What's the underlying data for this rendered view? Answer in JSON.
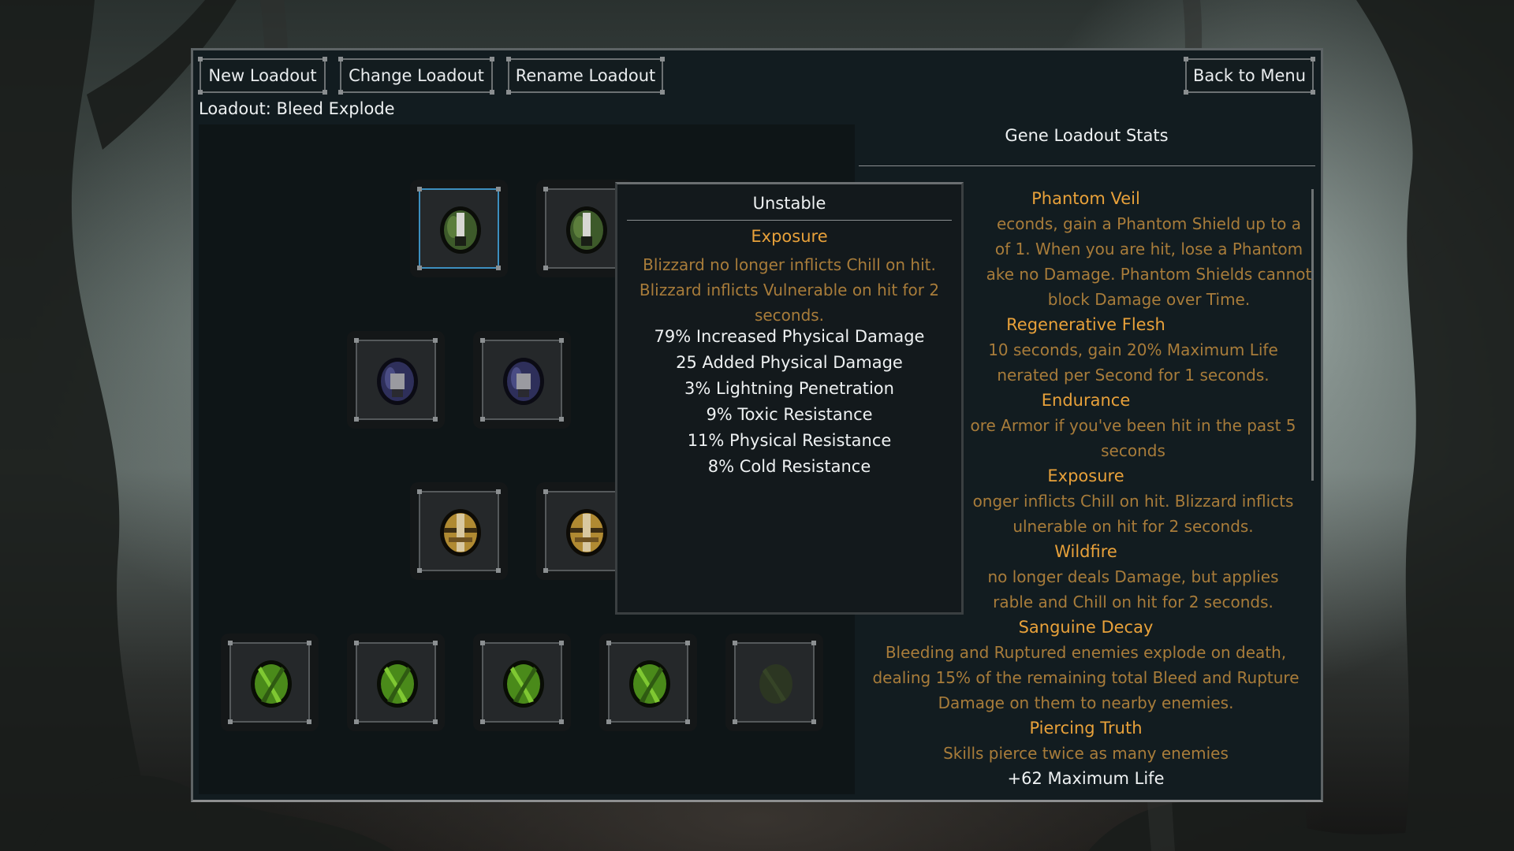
{
  "toolbar": {
    "new_loadout": "New Loadout",
    "change_loadout": "Change Loadout",
    "rename_loadout": "Rename Loadout",
    "back_to_menu": "Back to Menu"
  },
  "loadout_label": "Loadout: Bleed Explode",
  "gene_rows": [
    {
      "genes": [
        "green-gene",
        "green-gene"
      ],
      "selected_index": 0
    },
    {
      "genes": [
        "purple-gene",
        "purple-gene"
      ]
    },
    {
      "genes": [
        "gold-gene",
        "gold-gene"
      ]
    },
    {
      "genes": [
        "lime-gene",
        "lime-gene",
        "lime-gene",
        "lime-gene",
        "dim-lime-gene"
      ]
    }
  ],
  "tooltip": {
    "title": "Unstable",
    "gene_name": "Exposure",
    "description": "Blizzard no longer inflicts Chill on hit. Blizzard inflicts Vulnerable on hit for 2 seconds.",
    "stats": [
      "79% Increased Physical Damage",
      "25 Added Physical Damage",
      "3% Lightning Penetration",
      "9% Toxic Resistance",
      "11% Physical Resistance",
      "8% Cold Resistance"
    ]
  },
  "stats_panel": {
    "title": "Gene Loadout Stats",
    "entries": [
      {
        "name": "Phantom Veil",
        "desc": "econds, gain a Phantom Shield up to a\nof 1. When you are hit, lose a Phantom\nake no Damage. Phantom Shields cannot\nblock Damage over Time."
      },
      {
        "name": "Regenerative Flesh",
        "desc": "10 seconds, gain 20% Maximum Life\nnerated per Second for 1 seconds."
      },
      {
        "name": "Endurance",
        "desc": "ore Armor if you've been hit in the past 5\nseconds"
      },
      {
        "name": "Exposure",
        "desc": "onger inflicts Chill on hit. Blizzard inflicts\nulnerable on hit for 2 seconds."
      },
      {
        "name": "Wildfire",
        "desc": "no longer deals Damage, but applies\nrable and Chill on hit for 2 seconds."
      },
      {
        "name": "Sanguine Decay",
        "desc": "Bleeding and Ruptured enemies explode on death,\ndealing 15% of the remaining total Bleed and Rupture\nDamage on them to nearby enemies."
      },
      {
        "name": "Piercing Truth",
        "desc": "Skills pierce twice as many enemies"
      }
    ],
    "trailing_stat": "+62 Maximum Life"
  },
  "colors": {
    "panel_bg": "#121c20",
    "accent_gold": "#e8a13a",
    "desc_gold": "#a87c3a",
    "selected_border": "#3d8fbf"
  }
}
